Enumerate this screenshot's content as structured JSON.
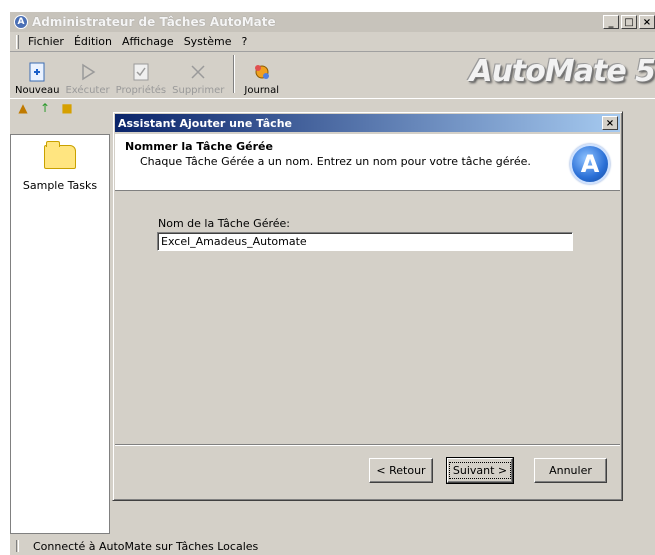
{
  "window": {
    "title": "Administrateur de Tâches AutoMate",
    "brand": "AutoMate 5",
    "controls": [
      "_",
      "□",
      "×"
    ]
  },
  "menu": [
    {
      "id": "fichier",
      "label": "Fichier"
    },
    {
      "id": "edition",
      "label": "Édition"
    },
    {
      "id": "affichage",
      "label": "Affichage"
    },
    {
      "id": "systeme",
      "label": "Système"
    },
    {
      "id": "help",
      "label": "?"
    }
  ],
  "toolbar": {
    "nouveau": "Nouveau",
    "executer": "Exécuter",
    "proprietes": "Propriétés",
    "supprimer": "Supprimer",
    "journal": "Journal"
  },
  "tree": {
    "folder_label": "Sample Tasks"
  },
  "status": {
    "text": "Connecté à AutoMate sur Tâches Locales"
  },
  "dialog": {
    "title": "Assistant Ajouter une Tâche",
    "header_title": "Nommer la Tâche Gérée",
    "header_subtitle": "Chaque Tâche Gérée a un nom. Entrez un nom pour votre tâche gérée.",
    "logo_letter": "A",
    "field_label": "Nom de la Tâche Gérée:",
    "field_value": "Excel_Amadeus_Automate",
    "buttons": {
      "back": "< Retour",
      "next": "Suivant >",
      "cancel": "Annuler"
    }
  },
  "colors": {
    "dialog_title_start": "#0a246a",
    "dialog_title_end": "#a6caf0",
    "chrome": "#d4d0c8"
  }
}
